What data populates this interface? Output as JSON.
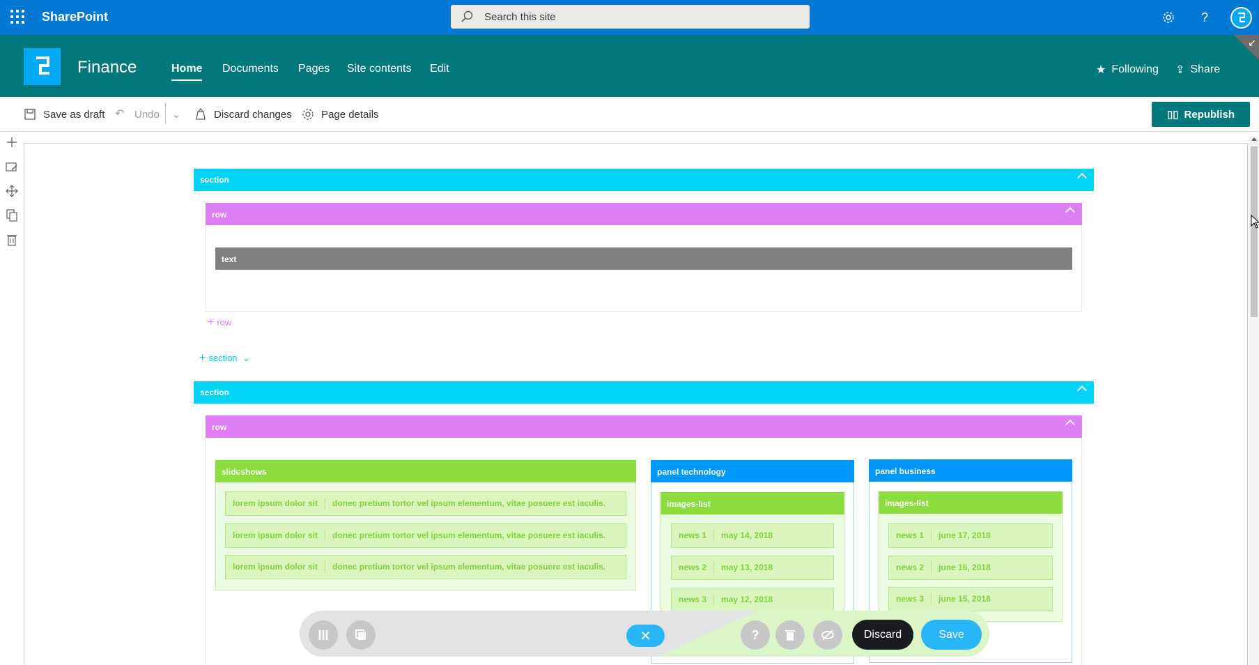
{
  "suite_bar": {
    "brand": "SharePoint",
    "search_placeholder": "Search this site",
    "settings_icon": "gear-icon",
    "help_label": "?"
  },
  "site_header": {
    "site_name": "Finance",
    "nav": [
      "Home",
      "Documents",
      "Pages",
      "Site contents",
      "Edit"
    ],
    "following_label": "Following",
    "share_label": "Share"
  },
  "command_bar": {
    "save_draft": "Save as draft",
    "undo": "Undo",
    "discard_changes": "Discard changes",
    "page_details": "Page details",
    "republish": "Republish"
  },
  "canvas": {
    "section1": {
      "label": "section",
      "row": {
        "label": "row",
        "text_label": "text"
      },
      "add_row": "row"
    },
    "add_section": "section",
    "section2": {
      "label": "section",
      "row": {
        "label": "row",
        "slideshows": {
          "label": "slideshows",
          "items": [
            {
              "a": "lorem ipsum dolor sit",
              "b": "donec pretium tortor vel ipsum elementum, vitae posuere est iaculis."
            },
            {
              "a": "lorem ipsum dolor sit",
              "b": "donec pretium tortor vel ipsum elementum, vitae posuere est iaculis."
            },
            {
              "a": "lorem ipsum dolor sit",
              "b": "donec pretium tortor vel ipsum elementum, vitae posuere est iaculis."
            }
          ]
        },
        "panel_technology": {
          "label": "panel technology",
          "list_label": "images-list",
          "items": [
            {
              "a": "news 1",
              "b": "may 14, 2018"
            },
            {
              "a": "news 2",
              "b": "may 13, 2018"
            },
            {
              "a": "news 3",
              "b": "may 12, 2018"
            }
          ]
        },
        "panel_business": {
          "label": "panel business",
          "list_label": "images-list",
          "items": [
            {
              "a": "news 1",
              "b": "june 17, 2018"
            },
            {
              "a": "news 2",
              "b": "june 16, 2018"
            },
            {
              "a": "news 3",
              "b": "june 15, 2018"
            }
          ]
        }
      }
    }
  },
  "floating_toolbar": {
    "help": "?",
    "discard": "Discard",
    "save": "Save"
  },
  "colors": {
    "suite_bar": "#0078d4",
    "site_header": "#03787c",
    "section": "#00d4f5",
    "row": "#dd7ef5",
    "text": "#808080",
    "green": "#8bdc3c",
    "panel": "#0097fb"
  }
}
